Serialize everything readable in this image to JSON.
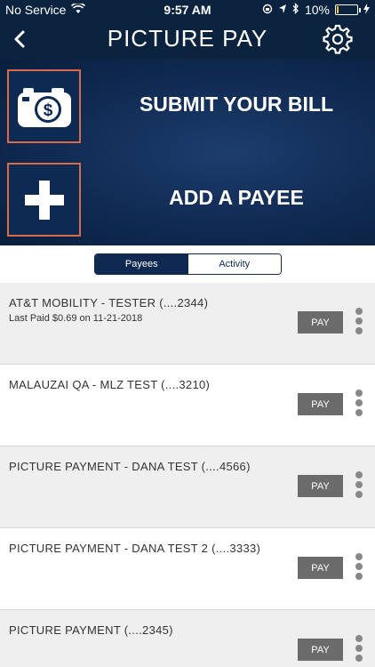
{
  "status_bar": {
    "carrier": "No Service",
    "time": "9:57 AM",
    "battery_percent": "10%",
    "battery_level": 0.1,
    "icons": [
      "wifi-icon",
      "screen-lock-icon",
      "location-icon",
      "bluetooth-icon",
      "battery-icon",
      "charging-icon"
    ]
  },
  "nav": {
    "title": "PICTURE PAY",
    "back_icon": "chevron-left-icon",
    "settings_icon": "gear-icon"
  },
  "actions": {
    "submit_bill": {
      "label": "SUBMIT YOUR BILL",
      "icon": "camera-dollar-icon"
    },
    "add_payee": {
      "label": "ADD A PAYEE",
      "icon": "plus-icon"
    }
  },
  "tabs": {
    "payees": "Payees",
    "activity": "Activity",
    "selected": "Payees"
  },
  "colors": {
    "navy": "#0c2340",
    "accent_border": "#d96a4e",
    "pay_button": "#6b6b6b"
  },
  "payees": [
    {
      "name": "AT&T MOBILITY - TESTER (....2344)",
      "last_paid": "Last Paid $0.69 on 11-21-2018",
      "pay_label": "PAY"
    },
    {
      "name": "MALAUZAI QA - MLZ TEST (....3210)",
      "last_paid": "",
      "pay_label": "PAY"
    },
    {
      "name": "PICTURE PAYMENT - DANA TEST (....4566)",
      "last_paid": "",
      "pay_label": "PAY"
    },
    {
      "name": "PICTURE PAYMENT - DANA TEST 2 (....3333)",
      "last_paid": "",
      "pay_label": "PAY"
    },
    {
      "name": "PICTURE PAYMENT (....2345)",
      "last_paid": "",
      "pay_label": "PAY"
    }
  ]
}
